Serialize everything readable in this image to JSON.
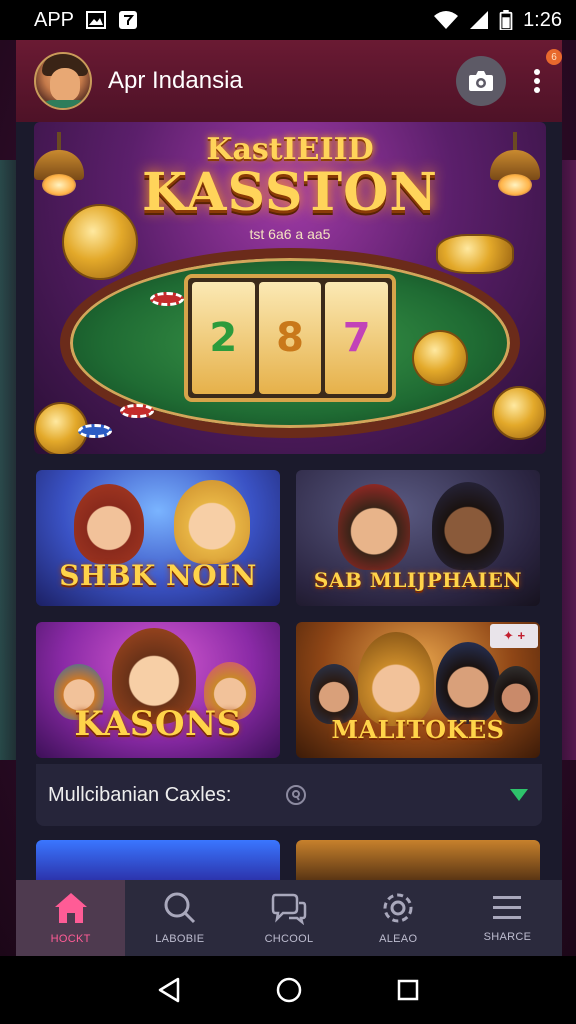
{
  "status_bar": {
    "app_label": "APP",
    "time": "1:26"
  },
  "header": {
    "title": "Apr Indansia",
    "notification_badge": "6"
  },
  "hero": {
    "title_top": "KastIEIID",
    "title": "KASSTON",
    "subtitle": "tst 6a6 a aa5",
    "reels": [
      "2",
      "8",
      "7"
    ]
  },
  "games": [
    {
      "label": "SHBK NOIN"
    },
    {
      "label": "SAB MLIJPHAIEN"
    },
    {
      "label": "KASONS"
    },
    {
      "label": "MALITOKES",
      "badge": "✦ +"
    }
  ],
  "caption": {
    "text": "Mullcibanian Caxles:"
  },
  "bottom_nav": {
    "items": [
      {
        "label": "HOCKT",
        "icon": "home-icon",
        "active": true
      },
      {
        "label": "LABOBIE",
        "icon": "search-icon",
        "active": false
      },
      {
        "label": "CHCOOL",
        "icon": "chat-icon",
        "active": false
      },
      {
        "label": "ALEAO",
        "icon": "settings-icon",
        "active": false
      },
      {
        "label": "SHARCE",
        "icon": "menu-icon",
        "active": false
      }
    ]
  },
  "colors": {
    "header": "#5a1530",
    "accent_pink": "#ff5c96",
    "nav_bg": "#2b2a3d",
    "gold": "#ffd45a",
    "green_indicator": "#2ec36b"
  }
}
